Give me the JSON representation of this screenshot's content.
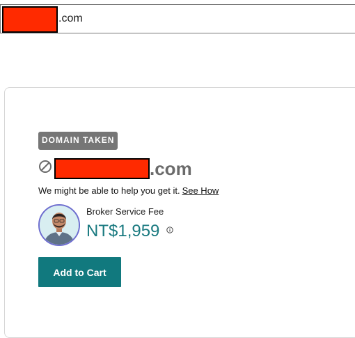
{
  "search": {
    "value_suffix": ".com"
  },
  "result": {
    "badge": "DOMAIN TAKEN",
    "domain_tld": ".com",
    "help_text": "We might be able to help you get it.",
    "help_link": "See How",
    "broker": {
      "label": "Broker Service Fee",
      "price": "NT$1,959"
    },
    "cta_label": "Add to Cart"
  },
  "icons": {
    "unavailable": "slashed-circle-icon",
    "info": "info-icon",
    "avatar": "broker-avatar"
  },
  "colors": {
    "badge_bg": "#767676",
    "price": "#1a7a80",
    "cta_bg": "#11797e",
    "avatar_ring": "#6e6ecf",
    "redaction": "#ff2a00"
  }
}
